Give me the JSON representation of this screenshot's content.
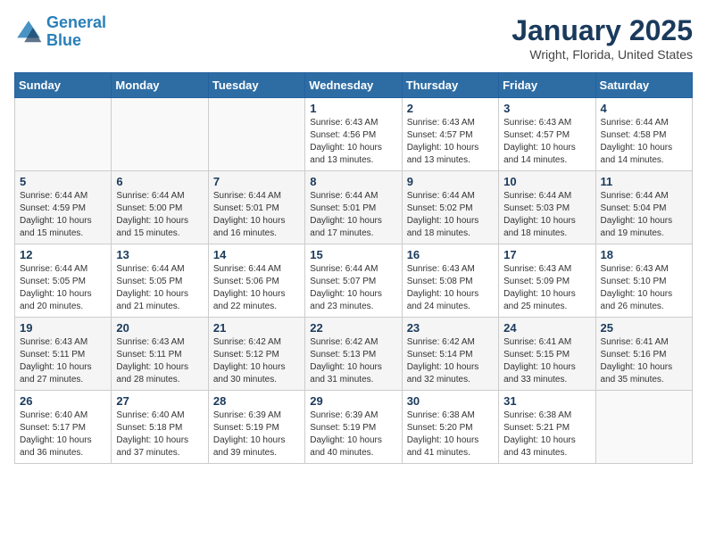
{
  "header": {
    "logo_line1": "General",
    "logo_line2": "Blue",
    "month": "January 2025",
    "location": "Wright, Florida, United States"
  },
  "weekdays": [
    "Sunday",
    "Monday",
    "Tuesday",
    "Wednesday",
    "Thursday",
    "Friday",
    "Saturday"
  ],
  "weeks": [
    [
      {
        "day": "",
        "info": ""
      },
      {
        "day": "",
        "info": ""
      },
      {
        "day": "",
        "info": ""
      },
      {
        "day": "1",
        "info": "Sunrise: 6:43 AM\nSunset: 4:56 PM\nDaylight: 10 hours\nand 13 minutes."
      },
      {
        "day": "2",
        "info": "Sunrise: 6:43 AM\nSunset: 4:57 PM\nDaylight: 10 hours\nand 13 minutes."
      },
      {
        "day": "3",
        "info": "Sunrise: 6:43 AM\nSunset: 4:57 PM\nDaylight: 10 hours\nand 14 minutes."
      },
      {
        "day": "4",
        "info": "Sunrise: 6:44 AM\nSunset: 4:58 PM\nDaylight: 10 hours\nand 14 minutes."
      }
    ],
    [
      {
        "day": "5",
        "info": "Sunrise: 6:44 AM\nSunset: 4:59 PM\nDaylight: 10 hours\nand 15 minutes."
      },
      {
        "day": "6",
        "info": "Sunrise: 6:44 AM\nSunset: 5:00 PM\nDaylight: 10 hours\nand 15 minutes."
      },
      {
        "day": "7",
        "info": "Sunrise: 6:44 AM\nSunset: 5:01 PM\nDaylight: 10 hours\nand 16 minutes."
      },
      {
        "day": "8",
        "info": "Sunrise: 6:44 AM\nSunset: 5:01 PM\nDaylight: 10 hours\nand 17 minutes."
      },
      {
        "day": "9",
        "info": "Sunrise: 6:44 AM\nSunset: 5:02 PM\nDaylight: 10 hours\nand 18 minutes."
      },
      {
        "day": "10",
        "info": "Sunrise: 6:44 AM\nSunset: 5:03 PM\nDaylight: 10 hours\nand 18 minutes."
      },
      {
        "day": "11",
        "info": "Sunrise: 6:44 AM\nSunset: 5:04 PM\nDaylight: 10 hours\nand 19 minutes."
      }
    ],
    [
      {
        "day": "12",
        "info": "Sunrise: 6:44 AM\nSunset: 5:05 PM\nDaylight: 10 hours\nand 20 minutes."
      },
      {
        "day": "13",
        "info": "Sunrise: 6:44 AM\nSunset: 5:05 PM\nDaylight: 10 hours\nand 21 minutes."
      },
      {
        "day": "14",
        "info": "Sunrise: 6:44 AM\nSunset: 5:06 PM\nDaylight: 10 hours\nand 22 minutes."
      },
      {
        "day": "15",
        "info": "Sunrise: 6:44 AM\nSunset: 5:07 PM\nDaylight: 10 hours\nand 23 minutes."
      },
      {
        "day": "16",
        "info": "Sunrise: 6:43 AM\nSunset: 5:08 PM\nDaylight: 10 hours\nand 24 minutes."
      },
      {
        "day": "17",
        "info": "Sunrise: 6:43 AM\nSunset: 5:09 PM\nDaylight: 10 hours\nand 25 minutes."
      },
      {
        "day": "18",
        "info": "Sunrise: 6:43 AM\nSunset: 5:10 PM\nDaylight: 10 hours\nand 26 minutes."
      }
    ],
    [
      {
        "day": "19",
        "info": "Sunrise: 6:43 AM\nSunset: 5:11 PM\nDaylight: 10 hours\nand 27 minutes."
      },
      {
        "day": "20",
        "info": "Sunrise: 6:43 AM\nSunset: 5:11 PM\nDaylight: 10 hours\nand 28 minutes."
      },
      {
        "day": "21",
        "info": "Sunrise: 6:42 AM\nSunset: 5:12 PM\nDaylight: 10 hours\nand 30 minutes."
      },
      {
        "day": "22",
        "info": "Sunrise: 6:42 AM\nSunset: 5:13 PM\nDaylight: 10 hours\nand 31 minutes."
      },
      {
        "day": "23",
        "info": "Sunrise: 6:42 AM\nSunset: 5:14 PM\nDaylight: 10 hours\nand 32 minutes."
      },
      {
        "day": "24",
        "info": "Sunrise: 6:41 AM\nSunset: 5:15 PM\nDaylight: 10 hours\nand 33 minutes."
      },
      {
        "day": "25",
        "info": "Sunrise: 6:41 AM\nSunset: 5:16 PM\nDaylight: 10 hours\nand 35 minutes."
      }
    ],
    [
      {
        "day": "26",
        "info": "Sunrise: 6:40 AM\nSunset: 5:17 PM\nDaylight: 10 hours\nand 36 minutes."
      },
      {
        "day": "27",
        "info": "Sunrise: 6:40 AM\nSunset: 5:18 PM\nDaylight: 10 hours\nand 37 minutes."
      },
      {
        "day": "28",
        "info": "Sunrise: 6:39 AM\nSunset: 5:19 PM\nDaylight: 10 hours\nand 39 minutes."
      },
      {
        "day": "29",
        "info": "Sunrise: 6:39 AM\nSunset: 5:19 PM\nDaylight: 10 hours\nand 40 minutes."
      },
      {
        "day": "30",
        "info": "Sunrise: 6:38 AM\nSunset: 5:20 PM\nDaylight: 10 hours\nand 41 minutes."
      },
      {
        "day": "31",
        "info": "Sunrise: 6:38 AM\nSunset: 5:21 PM\nDaylight: 10 hours\nand 43 minutes."
      },
      {
        "day": "",
        "info": ""
      }
    ]
  ]
}
